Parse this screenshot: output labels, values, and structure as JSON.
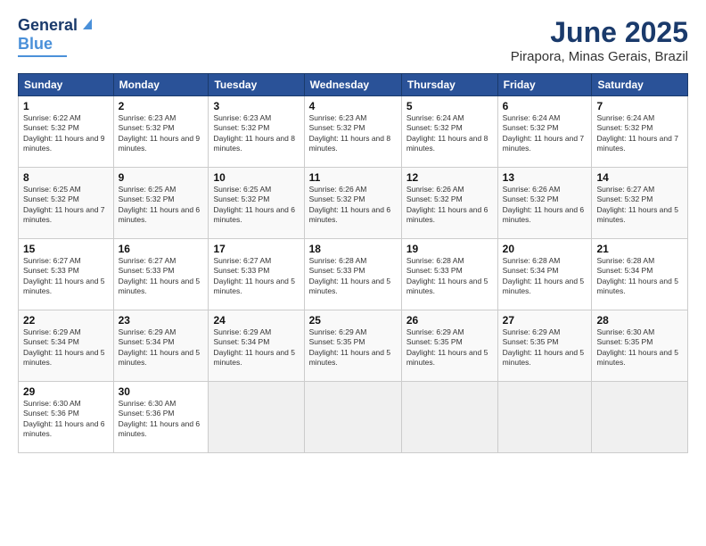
{
  "logo": {
    "line1": "General",
    "line2": "Blue"
  },
  "header": {
    "title": "June 2025",
    "subtitle": "Pirapora, Minas Gerais, Brazil"
  },
  "days_of_week": [
    "Sunday",
    "Monday",
    "Tuesday",
    "Wednesday",
    "Thursday",
    "Friday",
    "Saturday"
  ],
  "weeks": [
    [
      {
        "day": "1",
        "sunrise": "Sunrise: 6:22 AM",
        "sunset": "Sunset: 5:32 PM",
        "daylight": "Daylight: 11 hours and 9 minutes."
      },
      {
        "day": "2",
        "sunrise": "Sunrise: 6:23 AM",
        "sunset": "Sunset: 5:32 PM",
        "daylight": "Daylight: 11 hours and 9 minutes."
      },
      {
        "day": "3",
        "sunrise": "Sunrise: 6:23 AM",
        "sunset": "Sunset: 5:32 PM",
        "daylight": "Daylight: 11 hours and 8 minutes."
      },
      {
        "day": "4",
        "sunrise": "Sunrise: 6:23 AM",
        "sunset": "Sunset: 5:32 PM",
        "daylight": "Daylight: 11 hours and 8 minutes."
      },
      {
        "day": "5",
        "sunrise": "Sunrise: 6:24 AM",
        "sunset": "Sunset: 5:32 PM",
        "daylight": "Daylight: 11 hours and 8 minutes."
      },
      {
        "day": "6",
        "sunrise": "Sunrise: 6:24 AM",
        "sunset": "Sunset: 5:32 PM",
        "daylight": "Daylight: 11 hours and 7 minutes."
      },
      {
        "day": "7",
        "sunrise": "Sunrise: 6:24 AM",
        "sunset": "Sunset: 5:32 PM",
        "daylight": "Daylight: 11 hours and 7 minutes."
      }
    ],
    [
      {
        "day": "8",
        "sunrise": "Sunrise: 6:25 AM",
        "sunset": "Sunset: 5:32 PM",
        "daylight": "Daylight: 11 hours and 7 minutes."
      },
      {
        "day": "9",
        "sunrise": "Sunrise: 6:25 AM",
        "sunset": "Sunset: 5:32 PM",
        "daylight": "Daylight: 11 hours and 6 minutes."
      },
      {
        "day": "10",
        "sunrise": "Sunrise: 6:25 AM",
        "sunset": "Sunset: 5:32 PM",
        "daylight": "Daylight: 11 hours and 6 minutes."
      },
      {
        "day": "11",
        "sunrise": "Sunrise: 6:26 AM",
        "sunset": "Sunset: 5:32 PM",
        "daylight": "Daylight: 11 hours and 6 minutes."
      },
      {
        "day": "12",
        "sunrise": "Sunrise: 6:26 AM",
        "sunset": "Sunset: 5:32 PM",
        "daylight": "Daylight: 11 hours and 6 minutes."
      },
      {
        "day": "13",
        "sunrise": "Sunrise: 6:26 AM",
        "sunset": "Sunset: 5:32 PM",
        "daylight": "Daylight: 11 hours and 6 minutes."
      },
      {
        "day": "14",
        "sunrise": "Sunrise: 6:27 AM",
        "sunset": "Sunset: 5:32 PM",
        "daylight": "Daylight: 11 hours and 5 minutes."
      }
    ],
    [
      {
        "day": "15",
        "sunrise": "Sunrise: 6:27 AM",
        "sunset": "Sunset: 5:33 PM",
        "daylight": "Daylight: 11 hours and 5 minutes."
      },
      {
        "day": "16",
        "sunrise": "Sunrise: 6:27 AM",
        "sunset": "Sunset: 5:33 PM",
        "daylight": "Daylight: 11 hours and 5 minutes."
      },
      {
        "day": "17",
        "sunrise": "Sunrise: 6:27 AM",
        "sunset": "Sunset: 5:33 PM",
        "daylight": "Daylight: 11 hours and 5 minutes."
      },
      {
        "day": "18",
        "sunrise": "Sunrise: 6:28 AM",
        "sunset": "Sunset: 5:33 PM",
        "daylight": "Daylight: 11 hours and 5 minutes."
      },
      {
        "day": "19",
        "sunrise": "Sunrise: 6:28 AM",
        "sunset": "Sunset: 5:33 PM",
        "daylight": "Daylight: 11 hours and 5 minutes."
      },
      {
        "day": "20",
        "sunrise": "Sunrise: 6:28 AM",
        "sunset": "Sunset: 5:34 PM",
        "daylight": "Daylight: 11 hours and 5 minutes."
      },
      {
        "day": "21",
        "sunrise": "Sunrise: 6:28 AM",
        "sunset": "Sunset: 5:34 PM",
        "daylight": "Daylight: 11 hours and 5 minutes."
      }
    ],
    [
      {
        "day": "22",
        "sunrise": "Sunrise: 6:29 AM",
        "sunset": "Sunset: 5:34 PM",
        "daylight": "Daylight: 11 hours and 5 minutes."
      },
      {
        "day": "23",
        "sunrise": "Sunrise: 6:29 AM",
        "sunset": "Sunset: 5:34 PM",
        "daylight": "Daylight: 11 hours and 5 minutes."
      },
      {
        "day": "24",
        "sunrise": "Sunrise: 6:29 AM",
        "sunset": "Sunset: 5:34 PM",
        "daylight": "Daylight: 11 hours and 5 minutes."
      },
      {
        "day": "25",
        "sunrise": "Sunrise: 6:29 AM",
        "sunset": "Sunset: 5:35 PM",
        "daylight": "Daylight: 11 hours and 5 minutes."
      },
      {
        "day": "26",
        "sunrise": "Sunrise: 6:29 AM",
        "sunset": "Sunset: 5:35 PM",
        "daylight": "Daylight: 11 hours and 5 minutes."
      },
      {
        "day": "27",
        "sunrise": "Sunrise: 6:29 AM",
        "sunset": "Sunset: 5:35 PM",
        "daylight": "Daylight: 11 hours and 5 minutes."
      },
      {
        "day": "28",
        "sunrise": "Sunrise: 6:30 AM",
        "sunset": "Sunset: 5:35 PM",
        "daylight": "Daylight: 11 hours and 5 minutes."
      }
    ],
    [
      {
        "day": "29",
        "sunrise": "Sunrise: 6:30 AM",
        "sunset": "Sunset: 5:36 PM",
        "daylight": "Daylight: 11 hours and 6 minutes."
      },
      {
        "day": "30",
        "sunrise": "Sunrise: 6:30 AM",
        "sunset": "Sunset: 5:36 PM",
        "daylight": "Daylight: 11 hours and 6 minutes."
      },
      null,
      null,
      null,
      null,
      null
    ]
  ]
}
